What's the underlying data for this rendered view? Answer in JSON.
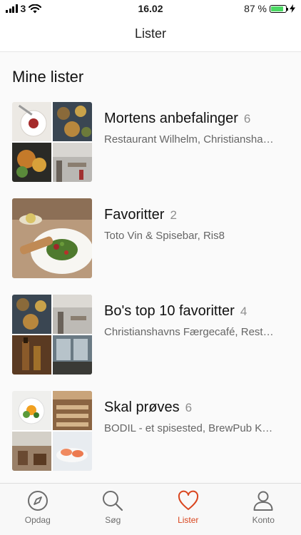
{
  "status_bar": {
    "carrier": "3",
    "time": "16.02",
    "battery": "87 %",
    "battery_level": 0.87
  },
  "nav": {
    "title": "Lister"
  },
  "section": {
    "title": "Mine lister"
  },
  "lists": [
    {
      "title": "Mortens anbefalinger",
      "count": "6",
      "subtitle": "Restaurant Wilhelm, Christianshavns Færgecafé"
    },
    {
      "title": "Favoritter",
      "count": "2",
      "subtitle": "Toto Vin & Spisebar, Ris8"
    },
    {
      "title": "Bo's top 10 favoritter",
      "count": "4",
      "subtitle": "Christianshavns Færgecafé, Restaurant Wilhelm"
    },
    {
      "title": "Skal prøves",
      "count": "6",
      "subtitle": "BODIL - et spisested, BrewPub København"
    }
  ],
  "tabs": [
    {
      "label": "Opdag",
      "icon": "compass-icon",
      "active": false
    },
    {
      "label": "Søg",
      "icon": "search-icon",
      "active": false
    },
    {
      "label": "Lister",
      "icon": "heart-icon",
      "active": true
    },
    {
      "label": "Konto",
      "icon": "user-icon",
      "active": false
    }
  ],
  "colors": {
    "accent": "#d9461f",
    "inactive": "#6d6d6d",
    "battery": "#4cd964"
  }
}
